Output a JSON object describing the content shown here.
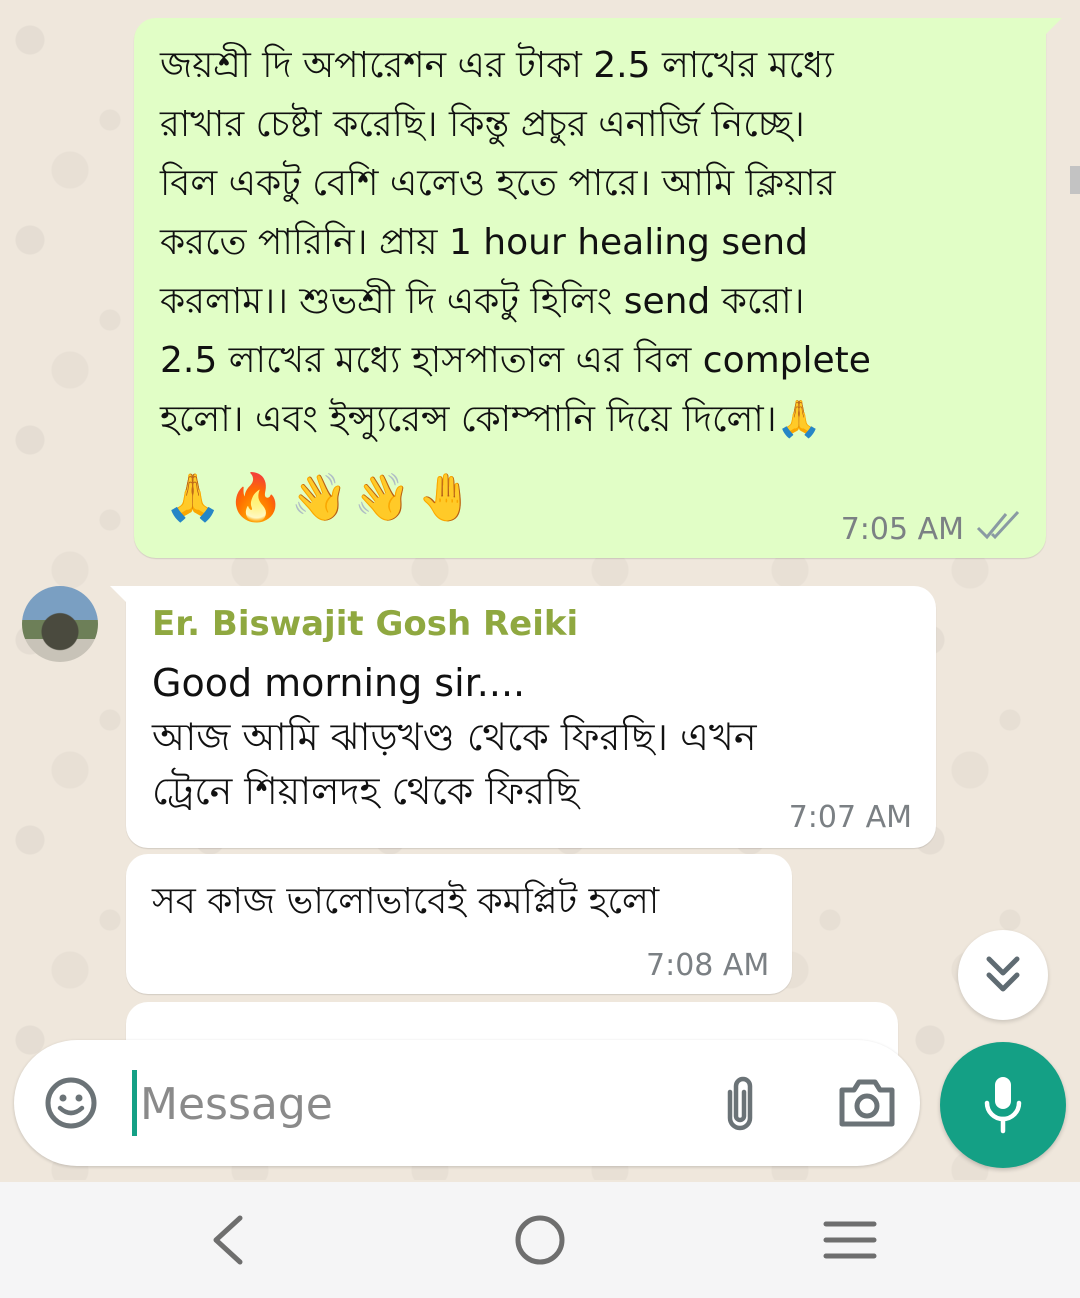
{
  "outgoing_message": {
    "text": "জয়শ্রী দি অপারেশন এর টাকা 2.5 লাখের মধ্যে\nরাখার চেষ্টা করেছি। কিন্তু প্রচুর এনার্জি নিচ্ছে।\nবিল একটু বেশি এলেও হতে পারে। আমি ক্লিয়ার\nকরতে পারিনি। প্রায় 1 hour healing send\nকরলাম।। শুভশ্রী দি একটু হিলিং send করো।\n2.5 লাখের মধ্যে হাসপাতাল এর বিল complete\nহলো। এবং ইন্স্যুরেন্স কোম্পানি দিয়ে দিলো।🙏",
    "emojis": "🙏🔥👋👋🤚",
    "time": "7:05 AM",
    "status_icon": "double-check-icon"
  },
  "incoming_messages": [
    {
      "sender": "Er. Biswajit Gosh Reiki",
      "text": "Good morning sir....\nআজ আমি ঝাড়খণ্ড থেকে ফিরছি। এখন\nট্রেনে শিয়ালদহ থেকে ফিরছি",
      "time": "7:07 AM"
    },
    {
      "text": "সব কাজ ভালোভাবেই কমপ্লিট হলো",
      "time": "7:08 AM"
    }
  ],
  "input": {
    "placeholder": "Message"
  },
  "colors": {
    "outgoing_bubble": "#e1fec6",
    "incoming_bubble": "#ffffff",
    "accent": "#14a085",
    "sender_name": "#8fa840",
    "chat_background": "#efe7dc"
  },
  "icons": {
    "emoji_button": "smiley-icon",
    "attach_button": "paperclip-icon",
    "camera_button": "camera-icon",
    "mic_button": "microphone-icon",
    "scroll_down": "double-chevron-down-icon",
    "nav_back": "back-icon",
    "nav_home": "home-icon",
    "nav_recents": "recents-icon"
  }
}
